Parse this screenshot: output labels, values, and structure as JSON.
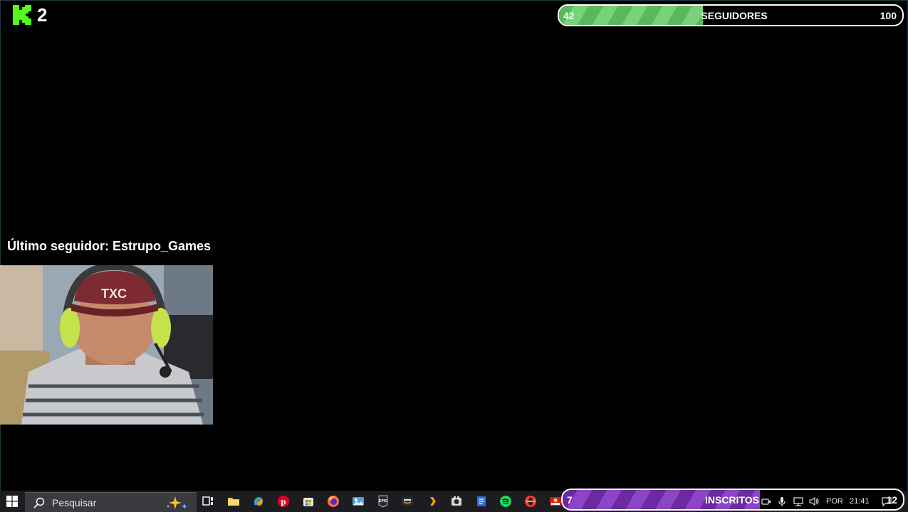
{
  "overlay": {
    "viewer_count": "2",
    "kick_logo_icon": "kick-logo-icon",
    "followers_goal": {
      "current": "42",
      "label": "SEGUIDORES",
      "target": "100",
      "fill_fraction": 0.42,
      "color": "#58b85a"
    },
    "subscribers_goal": {
      "current": "7",
      "label": "INSCRITOS",
      "target": "12",
      "fill_fraction": 0.58,
      "color": "#6a2aa0"
    },
    "last_follower": "Último seguidor: Estrupo_Games",
    "webcam_cap_text": "TXC"
  },
  "taskbar": {
    "start_icon": "windows-start-icon",
    "search_placeholder": "Pesquisar",
    "icons": [
      "task-view-icon",
      "file-explorer-icon",
      "copilot-icon",
      "pinterest-icon",
      "microsoft-store-icon",
      "firefox-icon",
      "photos-icon",
      "epic-games-icon",
      "amazon-prime-icon",
      "plex-icon",
      "obs-icon",
      "notepad-icon",
      "spotify-icon",
      "opera-icon",
      "poker-icon"
    ],
    "tray": {
      "language": "POR",
      "time": "21:41",
      "icons": [
        "camera-icon",
        "microphone-icon",
        "network-icon",
        "volume-icon",
        "notification-icon"
      ]
    }
  }
}
